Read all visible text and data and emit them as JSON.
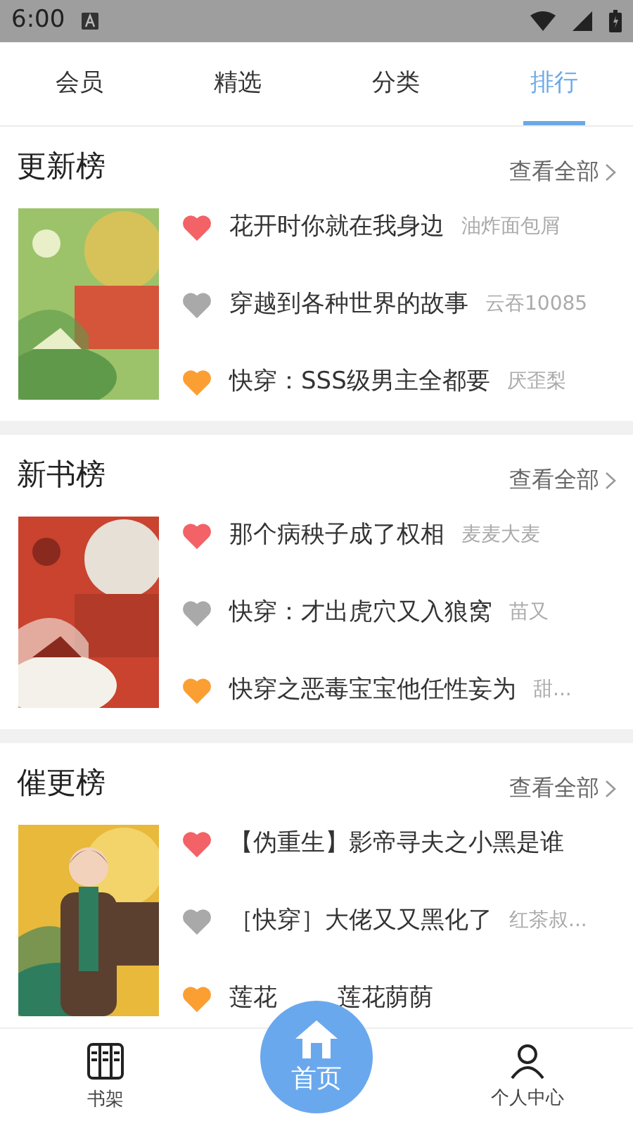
{
  "status_bar": {
    "time": "6:00"
  },
  "tabs": [
    {
      "label": "会员",
      "selected": false
    },
    {
      "label": "精选",
      "selected": false
    },
    {
      "label": "分类",
      "selected": false
    },
    {
      "label": "排行",
      "selected": true
    }
  ],
  "sections": [
    {
      "title": "更新榜",
      "more": "查看全部",
      "cover": {
        "kind": "picture"
      },
      "books": [
        {
          "title": "花开时你就在我身边",
          "author": "油炸面包屑",
          "color": "#f26266"
        },
        {
          "title": "穿越到各种世界的故事",
          "author": "云吞10085",
          "color": "#a9a9a9"
        },
        {
          "title": "快穿：SSS级男主全都要",
          "author": "厌歪梨",
          "color": "#fb9f33"
        }
      ]
    },
    {
      "title": "新书榜",
      "more": "查看全部",
      "cover": {
        "kind": "picture"
      },
      "books": [
        {
          "title": "那个病秧子成了权相",
          "author": "麦麦大麦",
          "color": "#f26266"
        },
        {
          "title": "快穿：才出虎穴又入狼窝",
          "author": "苗又",
          "color": "#a9a9a9"
        },
        {
          "title": "快穿之恶毒宝宝他任性妄为",
          "author": "甜...",
          "color": "#fb9f33"
        }
      ]
    },
    {
      "title": "催更榜",
      "more": "查看全部",
      "cover": {
        "kind": "picture"
      },
      "books": [
        {
          "title": "【伪重生】影帝寻夫之小黑是谁",
          "color": "#f26266"
        },
        {
          "title": "［快穿］大佬又又黑化了",
          "author": "红茶叔...",
          "color": "#a9a9a9"
        },
        {
          "title": "莲花",
          "title_tail": "莲花荫荫",
          "color": "#fb9f33"
        }
      ]
    }
  ],
  "nav": [
    {
      "label": "书架",
      "kind": "shelf"
    },
    {
      "label": "首页",
      "kind": "home"
    },
    {
      "label": "个人中心",
      "kind": "user"
    }
  ]
}
